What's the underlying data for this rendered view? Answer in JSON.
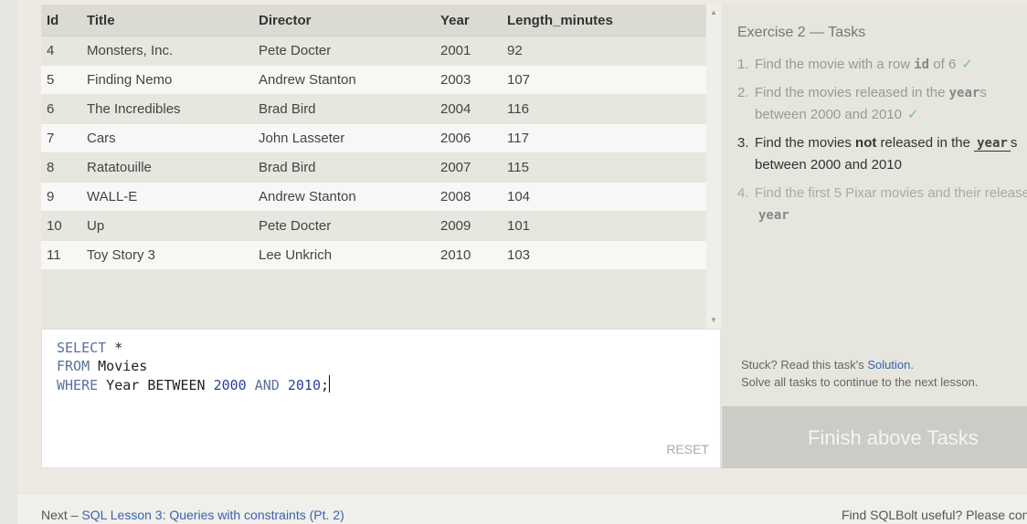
{
  "table": {
    "headers": [
      "Id",
      "Title",
      "Director",
      "Year",
      "Length_minutes"
    ],
    "rows": [
      [
        "4",
        "Monsters, Inc.",
        "Pete Docter",
        "2001",
        "92"
      ],
      [
        "5",
        "Finding Nemo",
        "Andrew Stanton",
        "2003",
        "107"
      ],
      [
        "6",
        "The Incredibles",
        "Brad Bird",
        "2004",
        "116"
      ],
      [
        "7",
        "Cars",
        "John Lasseter",
        "2006",
        "117"
      ],
      [
        "8",
        "Ratatouille",
        "Brad Bird",
        "2007",
        "115"
      ],
      [
        "9",
        "WALL-E",
        "Andrew Stanton",
        "2008",
        "104"
      ],
      [
        "10",
        "Up",
        "Pete Docter",
        "2009",
        "101"
      ],
      [
        "11",
        "Toy Story 3",
        "Lee Unkrich",
        "2010",
        "103"
      ]
    ]
  },
  "editor": {
    "line1_kw": "SELECT",
    "line1_rest": " *",
    "line2_kw": "FROM",
    "line2_rest": " Movies",
    "line3_kw": "WHERE",
    "line3_mid": " Year BETWEEN ",
    "line3_num1": "2000",
    "line3_and": " AND ",
    "line3_num2": "2010",
    "line3_end": ";",
    "reset_label": "RESET"
  },
  "tasks": {
    "title": "Exercise 2 — Tasks",
    "t1_num": "1.",
    "t1_a": "Find the movie with a row ",
    "t1_code": "id",
    "t1_b": " of 6",
    "t2_num": "2.",
    "t2_a": "Find the movies released in the ",
    "t2_code": "year",
    "t2_b": "s",
    "t2_line2": "between 2000 and 2010",
    "t3_num": "3.",
    "t3_a": "Find the movies ",
    "t3_bold": "not",
    "t3_b": " released in the ",
    "t3_code": "year",
    "t3_c": "s",
    "t3_line2": "between 2000 and 2010",
    "t4_num": "4.",
    "t4_a": "Find the first 5 Pixar movies and their release",
    "t4_code": "year",
    "check": "✓",
    "stuck_a": "Stuck? Read this task's ",
    "stuck_link": "Solution",
    "stuck_b": ".",
    "solve_all": "Solve all tasks to continue to the next lesson."
  },
  "finish_label": "Finish above Tasks",
  "footer": {
    "next_prefix": "Next – ",
    "next_link": "SQL Lesson 3: Queries with constraints (Pt. 2)",
    "useful": "Find SQLBolt useful? Please consider"
  }
}
